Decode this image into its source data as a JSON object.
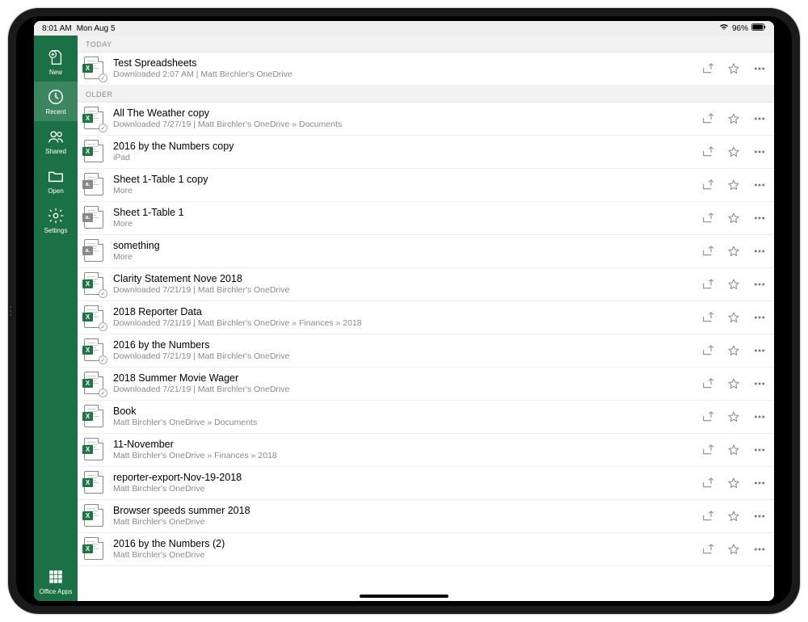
{
  "statusBar": {
    "time": "8:01 AM",
    "date": "Mon Aug 5",
    "battery": "96%"
  },
  "sidebar": {
    "items": [
      {
        "label": "New"
      },
      {
        "label": "Recent"
      },
      {
        "label": "Shared"
      },
      {
        "label": "Open"
      },
      {
        "label": "Settings"
      }
    ],
    "bottom": {
      "label": "Office Apps"
    },
    "selectedIndex": 1
  },
  "sections": [
    {
      "header": "TODAY",
      "files": [
        {
          "title": "Test Spreadsheets",
          "subtitle": "Downloaded 2:07 AM | Matt Birchler's OneDrive",
          "badge": "X",
          "cloud": true
        }
      ]
    },
    {
      "header": "OLDER",
      "files": [
        {
          "title": "All The Weather copy",
          "subtitle": "Downloaded 7/27/19 | Matt Birchler's OneDrive » Documents",
          "badge": "X",
          "cloud": true
        },
        {
          "title": "2016 by the Numbers copy",
          "subtitle": "iPad",
          "badge": "X",
          "cloud": false
        },
        {
          "title": "Sheet 1-Table 1 copy",
          "subtitle": "More",
          "badge": "a.",
          "generic": true,
          "cloud": false
        },
        {
          "title": "Sheet 1-Table 1",
          "subtitle": "More",
          "badge": "a.",
          "generic": true,
          "cloud": false
        },
        {
          "title": "something",
          "subtitle": "More",
          "badge": "a.",
          "generic": true,
          "cloud": false
        },
        {
          "title": "Clarity Statement Nove 2018",
          "subtitle": "Downloaded 7/21/19 | Matt Birchler's OneDrive",
          "badge": "X",
          "cloud": true
        },
        {
          "title": "2018 Reporter Data",
          "subtitle": "Downloaded 7/21/19 | Matt Birchler's OneDrive » Finances » 2018",
          "badge": "X",
          "cloud": true
        },
        {
          "title": "2016 by the Numbers",
          "subtitle": "Downloaded 7/21/19 | Matt Birchler's OneDrive",
          "badge": "X",
          "cloud": true
        },
        {
          "title": "2018 Summer Movie Wager",
          "subtitle": "Downloaded 7/21/19 | Matt Birchler's OneDrive",
          "badge": "X",
          "cloud": true
        },
        {
          "title": "Book",
          "subtitle": "Matt Birchler's OneDrive » Documents",
          "badge": "X",
          "cloud": false
        },
        {
          "title": "11-November",
          "subtitle": "Matt Birchler's OneDrive » Finances » 2018",
          "badge": "X",
          "cloud": false
        },
        {
          "title": "reporter-export-Nov-19-2018",
          "subtitle": "Matt Birchler's OneDrive",
          "badge": "X",
          "cloud": false
        },
        {
          "title": "Browser speeds summer 2018",
          "subtitle": "Matt Birchler's OneDrive",
          "badge": "X",
          "cloud": false
        },
        {
          "title": "2016 by the Numbers (2)",
          "subtitle": "Matt Birchler's OneDrive",
          "badge": "X",
          "cloud": false
        }
      ]
    }
  ]
}
